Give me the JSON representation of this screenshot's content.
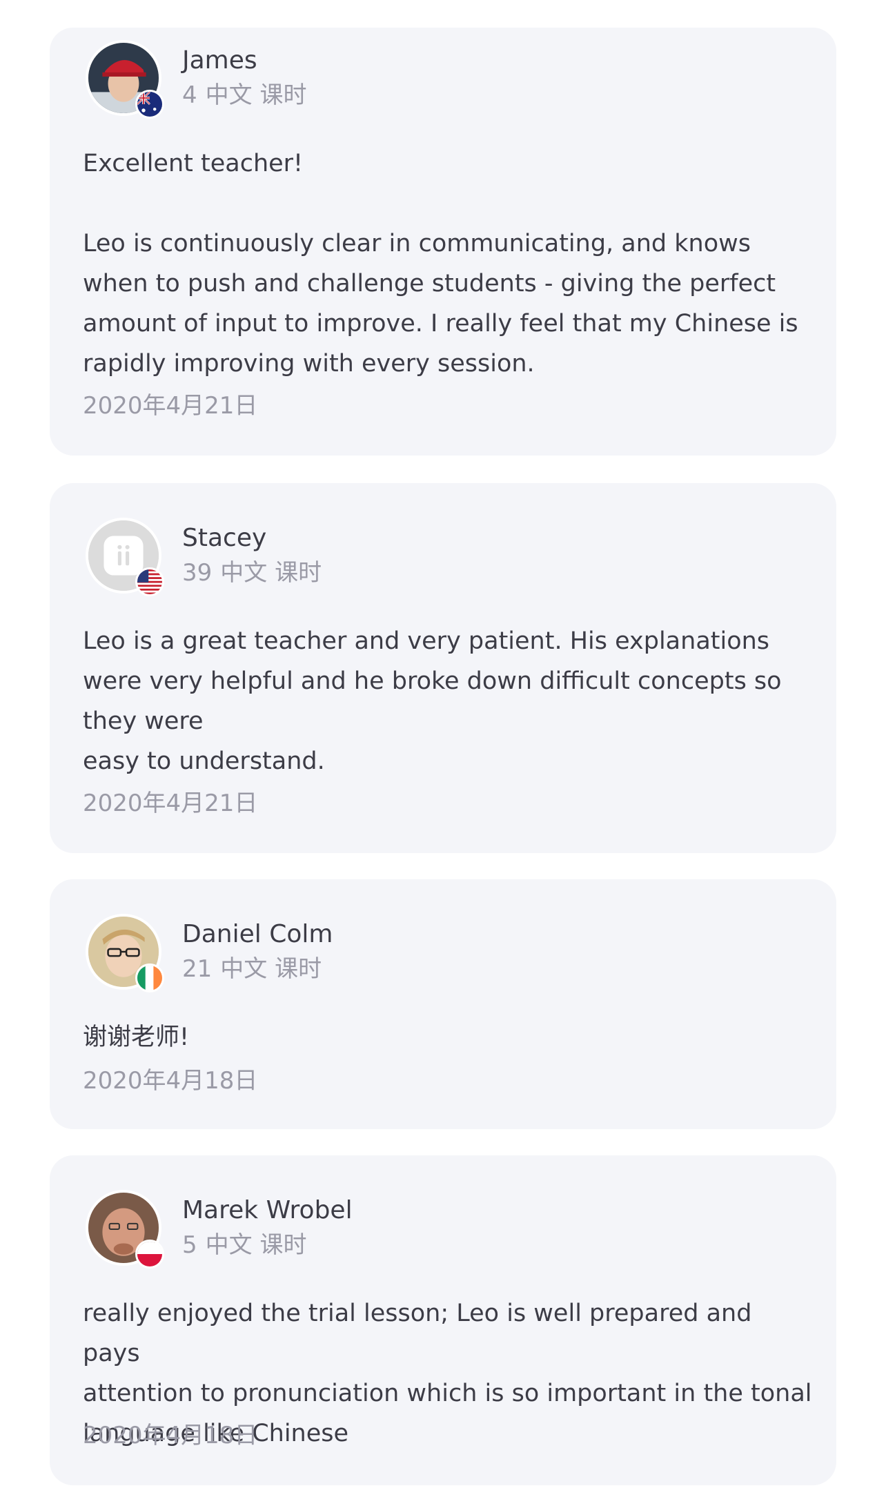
{
  "reviews": [
    {
      "name": "James",
      "lessons_count": "4",
      "lessons_label": "中文 课时",
      "flag": "australia-flag",
      "avatar": "user-photo-avatar",
      "lines": [
        "Excellent teacher!",
        "",
        "Leo is continuously clear in communicating, and knows",
        "when to push and challenge students - giving the perfect",
        "amount of input to improve. I really feel that my Chinese is",
        "rapidly improving with every session."
      ],
      "date": "2020年4月21日"
    },
    {
      "name": "Stacey",
      "lessons_count": "39",
      "lessons_label": "中文 课时",
      "flag": "united-states-flag",
      "avatar": "default-avatar",
      "lines": [
        "Leo is a great teacher and very patient. His explanations",
        "were very helpful and he broke down difficult concepts so",
        "they were",
        "easy to understand."
      ],
      "date": "2020年4月21日"
    },
    {
      "name": "Daniel Colm",
      "lessons_count": "21",
      "lessons_label": "中文 课时",
      "flag": "ireland-flag",
      "avatar": "user-photo-avatar",
      "lines": [
        "谢谢老师!"
      ],
      "date": "2020年4月18日"
    },
    {
      "name": "Marek Wrobel",
      "lessons_count": "5",
      "lessons_label": "中文 课时",
      "flag": "poland-flag",
      "avatar": "user-photo-avatar",
      "lines": [
        "really enjoyed the trial lesson; Leo is well prepared and pays",
        "attention to pronunciation which is so important in the tonal",
        "language like Chinese"
      ],
      "date": "2020年4月18日"
    }
  ],
  "colors": {
    "card_background": "#f4f5f9",
    "text_primary": "#3c3c46",
    "text_secondary": "#9a9aa6"
  }
}
